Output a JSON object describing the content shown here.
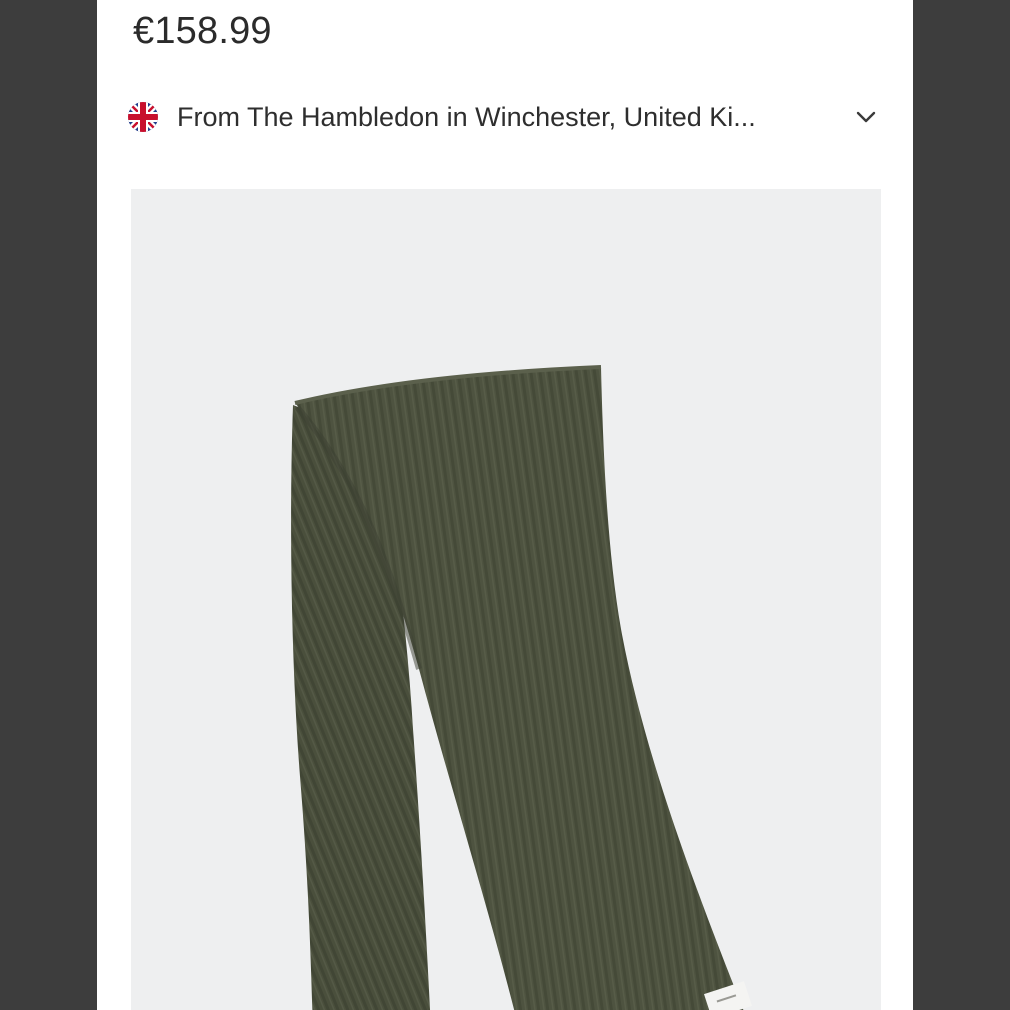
{
  "product": {
    "price": "€158.99",
    "origin": {
      "text": "From The Hambledon in Winchester, United Ki...",
      "flag_icon": "uk-flag-icon",
      "chevron_icon": "chevron-down-icon"
    },
    "image": {
      "subject": "scarf-image",
      "background_color": "#eeeff0",
      "item_color": "#4e5340"
    }
  }
}
